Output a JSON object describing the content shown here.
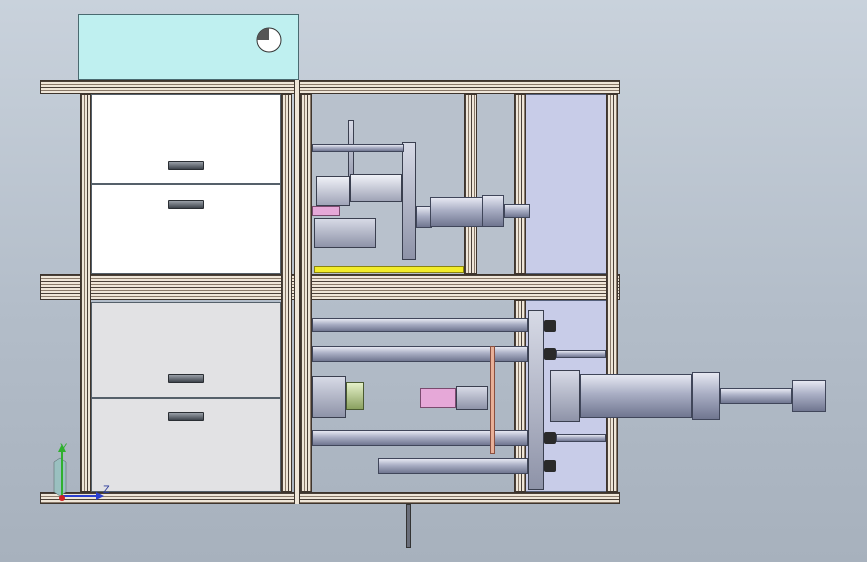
{
  "view": {
    "title": "",
    "background_top": "#c9d2dc",
    "background_bottom": "#a7b1bd"
  },
  "triad": {
    "y_label": "Y",
    "z_label": "Z",
    "y_color": "#2fb02f",
    "z_color": "#2b3fd0",
    "x_color": "#d02020"
  },
  "colors": {
    "electrical_box": "#bff0f0",
    "side_panel": "#c8cce8",
    "yellow_plate": "#f2ec2a",
    "pink_part": "#e6a8d8",
    "drawer_upper": "#ffffff",
    "drawer_lower": "#e2e2e4"
  },
  "icons": [
    "circular-indicator-icon",
    "coordinate-triad-icon"
  ]
}
